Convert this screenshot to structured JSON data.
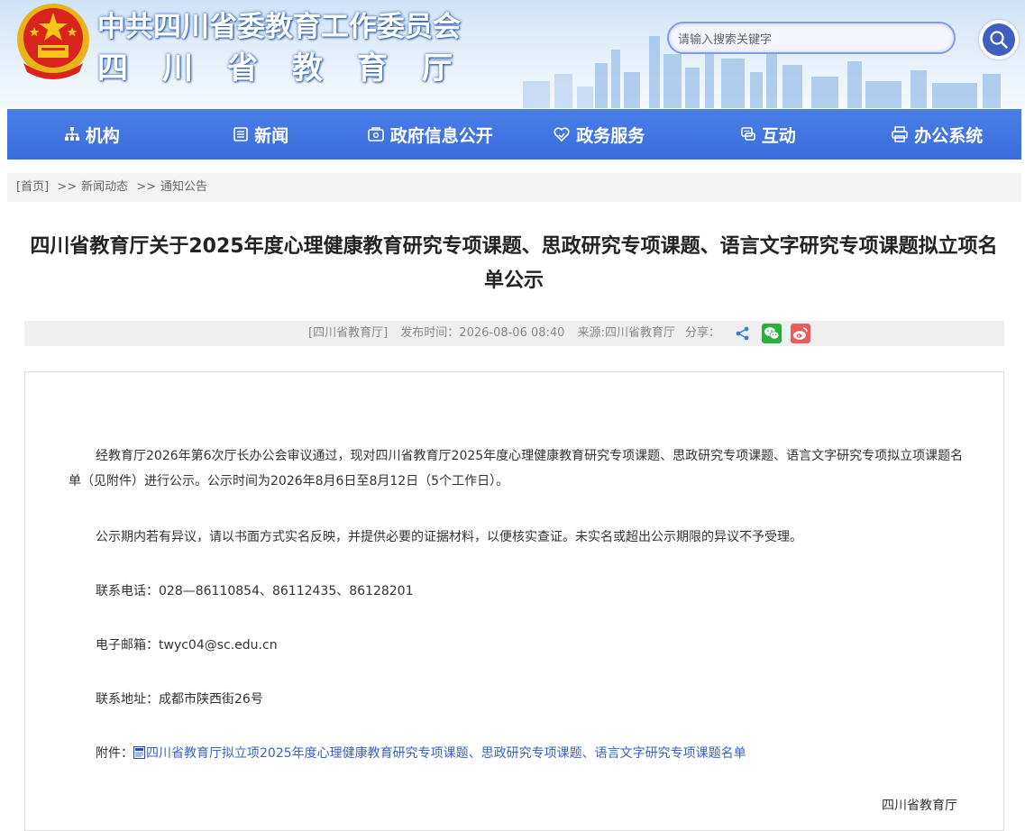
{
  "header": {
    "title_line1": "中共四川省委教育工作委员会",
    "title_line2": "四川省教育厅",
    "search": {
      "placeholder": "请输入搜索关键字"
    }
  },
  "nav": {
    "items": [
      {
        "label": "机构",
        "icon": "org-chart-icon"
      },
      {
        "label": "新闻",
        "icon": "news-icon"
      },
      {
        "label": "政府信息公开",
        "icon": "info-public-icon"
      },
      {
        "label": "政务服务",
        "icon": "service-heart-icon"
      },
      {
        "label": "互动",
        "icon": "chat-icon"
      },
      {
        "label": "办公系统",
        "icon": "printer-icon"
      }
    ]
  },
  "breadcrumb": {
    "home": "[首页]",
    "sep": ">>",
    "level1": "新闻动态",
    "level2": "通知公告"
  },
  "article": {
    "title": "四川省教育厅关于2025年度心理健康教育研究专项课题、思政研究专项课题、语言文字研究专项课题拟立项名单公示",
    "source": "[四川省教育厅]",
    "publish_time": "发布时间：2026-08-06 08:40",
    "origin": "来源:四川省教育厅",
    "share_label": "分享：",
    "paragraph1": "经教育厅2026年第6次厅长办公会审议通过，现对四川省教育厅2025年度心理健康教育研究专项课题、思政研究专项课题、语言文字研究专项拟立项课题名单（见附件）进行公示。公示时间为2026年8月6日至8月12日（5个工作日）。",
    "paragraph2": "公示期内若有异议，请以书面方式实名反映，并提供必要的证据材料，以便核实查证。未实名或超出公示期限的异议不予受理。",
    "phone_label": "联系电话：",
    "phone": "028—86110854、86112435、86128201",
    "email_label": "电子邮箱：",
    "email": "twyc04@sc.edu.cn",
    "address_label": "联系地址：",
    "address": "成都市陕西街26号",
    "attachment_label": "附件：",
    "attachment_link": "四川省教育厅拟立项2025年度心理健康教育研究专项课题、思政研究专项课题、语言文字研究专项课题名单",
    "signature": "四川省教育厅"
  },
  "colors": {
    "nav_bg": "#3a6ddc",
    "link": "#3a63c7",
    "wechat": "#2aae3c",
    "weibo": "#e85d5d"
  }
}
